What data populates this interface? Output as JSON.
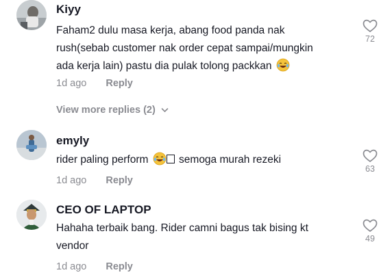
{
  "comments": [
    {
      "username": "Kiyy",
      "lines": [
        "Faham2 dulu masa kerja, abang food panda nak",
        "rush(sebab customer nak order cepat sampai/mungkin",
        "ada kerja lain) pastu dia pulak tolong packkan"
      ],
      "emoji": "😂",
      "time": "1d ago",
      "reply_label": "Reply",
      "likes": "72",
      "view_more": "View more replies (2)"
    },
    {
      "username": "emyly",
      "text_before": "rider paling perform",
      "emoji": "😂",
      "text_after": "semoga murah rezeki",
      "time": "1d ago",
      "reply_label": "Reply",
      "likes": "63"
    },
    {
      "username": "CEO OF LAPTOP",
      "lines": [
        "Hahaha terbaik bang. Rider camni bagus tak bising kt",
        "vendor"
      ],
      "time": "1d ago",
      "reply_label": "Reply",
      "likes": "49"
    }
  ],
  "icons": {
    "like": "heart-outline-icon",
    "expand": "chevron-down-icon",
    "emoji": "laughing-tears-emoji-icon"
  },
  "colors": {
    "text": "#161823",
    "muted": "#8a8b91",
    "background": "#ffffff",
    "emoji_face": "#f5c33b"
  }
}
